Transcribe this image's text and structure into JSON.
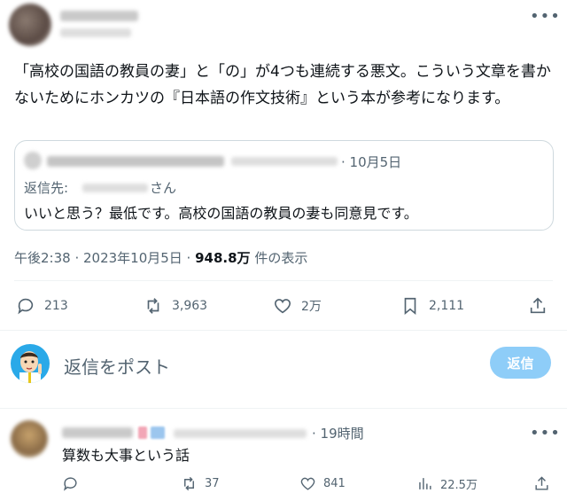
{
  "main_post": {
    "more_label": "•••",
    "text": "「高校の国語の教員の妻」と「の」が4つも連続する悪文。こういう文章を書かないためにホンカツの『日本語の作文技術』という本が参考になります。",
    "quote": {
      "date": "· 10月5日",
      "reply_to_label": "返信先:",
      "reply_to_suffix": "さん",
      "text": "いいと思う？最低です。高校の国語の教員の妻も同意見です。"
    },
    "meta": {
      "time": "午後2:38 · 2023年10月5日 · ",
      "views": "948.8万",
      "views_suffix": " 件の表示"
    },
    "actions": {
      "replies": "213",
      "reposts": "3,963",
      "likes": "2万",
      "bookmarks": "2,111"
    }
  },
  "composer": {
    "placeholder": "返信をポスト",
    "button_label": "返信"
  },
  "reply_post": {
    "time": "· 19時間",
    "more_label": "•••",
    "text": "算数も大事という話",
    "actions": {
      "reposts": "37",
      "likes": "841",
      "views": "22.5万"
    }
  },
  "colors": {
    "accent_disabled": "#8ecdf8",
    "muted": "#536471",
    "border": "#cfd9de"
  }
}
